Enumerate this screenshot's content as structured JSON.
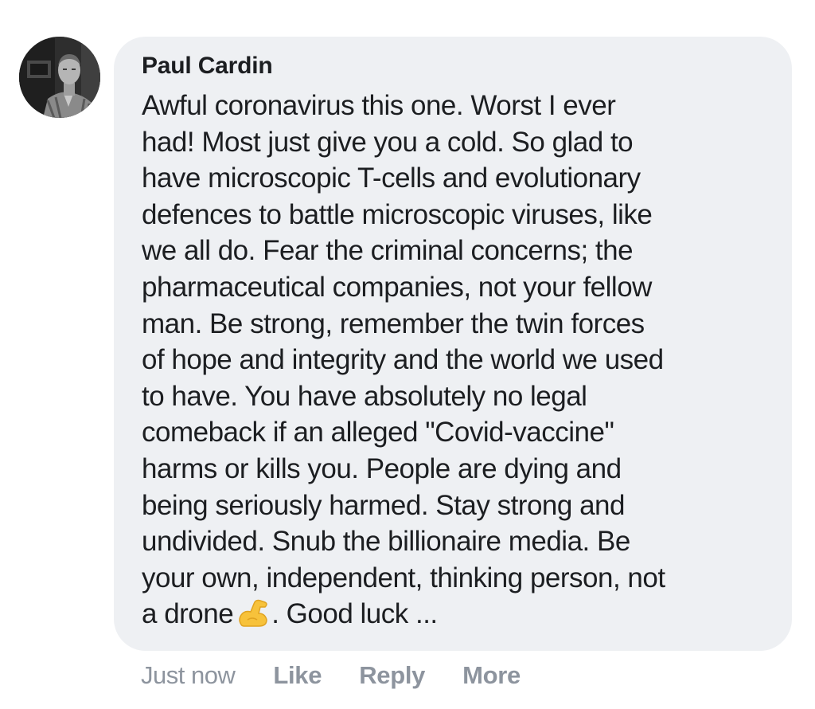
{
  "comment": {
    "author": "Paul Cardin",
    "lines": [
      "Awful coronavirus this one. Worst I ever",
      "had! Most just give you a cold. So glad to",
      "have microscopic T-cells and evolutionary",
      "defences to battle microscopic viruses, like",
      "we all do. Fear the criminal concerns; the",
      "pharmaceutical companies, not your fellow",
      "man. Be strong, remember the twin forces",
      "of hope and integrity and the world we used",
      "to have. You have absolutely no legal",
      "comeback if an alleged \"Covid-vaccine\"",
      "harms or kills you. People are dying and",
      "being seriously harmed. Stay strong and",
      "undivided. Snub the billionaire media. Be",
      "your own, independent, thinking person, not"
    ],
    "last_line_before_emoji": "a drone",
    "last_line_after_emoji": ". Good luck ...",
    "emoji": "flexed-biceps-icon",
    "timestamp": "Just now",
    "actions": {
      "like": "Like",
      "reply": "Reply",
      "more": "More"
    }
  },
  "colors": {
    "bubble_bg": "#eef0f3",
    "text": "#1c1e21",
    "meta": "#8d949e",
    "emoji": "#f7c23b"
  }
}
